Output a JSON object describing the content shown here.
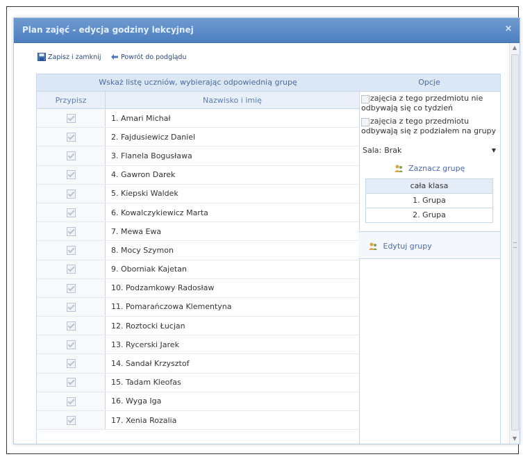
{
  "dialog": {
    "title": "Plan zajęć - edycja godziny lekcyjnej",
    "close_icon": "×"
  },
  "toolbar": {
    "save_label": "Zapisz i zamknij",
    "back_label": "Powrót do podglądu"
  },
  "left_panel": {
    "heading": "Wskaż listę uczniów, wybierając odpowiednią grupę",
    "col_present": "Przypisz",
    "col_name": "Nazwisko i imię",
    "students": [
      "1. Amari Michał",
      "2. Fajdusiewicz Daniel",
      "3. Flanela Bogusława",
      "4. Gawron Darek",
      "5. Kiepski Waldek",
      "6. Kowalczykiewicz Marta",
      "7. Mewa Ewa",
      "8. Mocy Szymon",
      "9. Oborniak Kajetan",
      "10. Podzamkowy Radosław",
      "11. Pomarańczowa Klementyna",
      "12. Roztocki Łucjan",
      "13. Rycerski Jarek",
      "14. Sandał Krzysztof",
      "15. Tadam Kleofas",
      "16. Wyga Iga",
      "17. Xenia Rozalia"
    ]
  },
  "right_panel": {
    "heading": "Opcje",
    "option1": "zajęcia z tego przedmiotu nie odbywają się co tydzień",
    "option2": "zajęcia z tego przedmiotu odbywają się z podziałem na grupy",
    "sala_label": "Sala:",
    "sala_value": "Brak",
    "mark_group": "Zaznacz grupę",
    "groups": [
      "cała klasa",
      "1. Grupa",
      "2. Grupa"
    ],
    "edit_groups": "Edytuj grupy"
  },
  "colors": {
    "titlebar": "#4d7fc0",
    "panel_head": "#dce7f5",
    "link": "#4b6aa8"
  }
}
